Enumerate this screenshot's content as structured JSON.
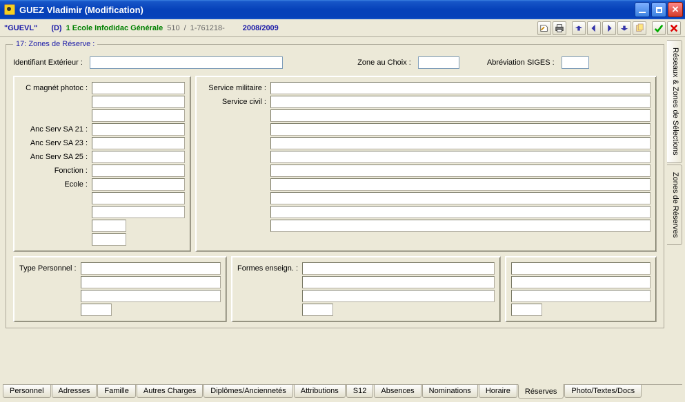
{
  "window": {
    "title": "GUEZ Vladimir (Modification)"
  },
  "toolbar": {
    "code": "\"GUEVL\"",
    "flag": "(D)",
    "school": "1 Ecole Infodidac Générale",
    "id1": "510",
    "sep1": "/",
    "id2": "1-761218-",
    "year": "2008/2009"
  },
  "section": {
    "legend": "17: Zones de Réserve :",
    "identifiant_label": "Identifiant Extérieur :",
    "identifiant_value": "",
    "zone_choix_label": "Zone au Choix :",
    "zone_choix_value": "",
    "abbrev_siges_label": "Abréviation SIGES :",
    "abbrev_siges_value": ""
  },
  "left_panel": {
    "c_magnet_label": "C magnét photoc :",
    "c_magnet_1": "",
    "c_magnet_2": "",
    "c_magnet_3": "",
    "anc21_label": "Anc Serv SA 21 :",
    "anc21": "",
    "anc23_label": "Anc Serv SA 23 :",
    "anc23": "",
    "anc25_label": "Anc Serv SA 25 :",
    "anc25": "",
    "fonction_label": "Fonction :",
    "fonction": "",
    "ecole_label": "Ecole :",
    "ecole": "",
    "extra1": "",
    "extra2": "",
    "extra3": "",
    "extra4": ""
  },
  "right_panel": {
    "service_militaire_label": "Service militaire :",
    "service_militaire": "",
    "service_civil_label": "Service civil :",
    "service_civil": "",
    "r3": "",
    "r4": "",
    "r5": "",
    "r6": "",
    "r7": "",
    "r8": "",
    "r9": "",
    "r10": "",
    "r11": ""
  },
  "bottom_panels": {
    "type_personnel_label": "Type Personnel :",
    "tp1": "",
    "tp2": "",
    "tp3": "",
    "tp4": "",
    "formes_enseign_label": "Formes enseign. :",
    "fe1": "",
    "fe2": "",
    "fe3": "",
    "fe4": "",
    "x1": "",
    "x2": "",
    "x3": "",
    "x4": ""
  },
  "side_tabs": {
    "tab1": "Réseaux & Zones de Sélections",
    "tab2": "Zones de Réserves"
  },
  "bottom_tabs": {
    "t1": "Personnel",
    "t2": "Adresses",
    "t3": "Famille",
    "t4": "Autres Charges",
    "t5": "Diplômes/Anciennetés",
    "t6": "Attributions",
    "t7": "S12",
    "t8": "Absences",
    "t9": "Nominations",
    "t10": "Horaire",
    "t11": "Réserves",
    "t12": "Photo/Textes/Docs"
  }
}
